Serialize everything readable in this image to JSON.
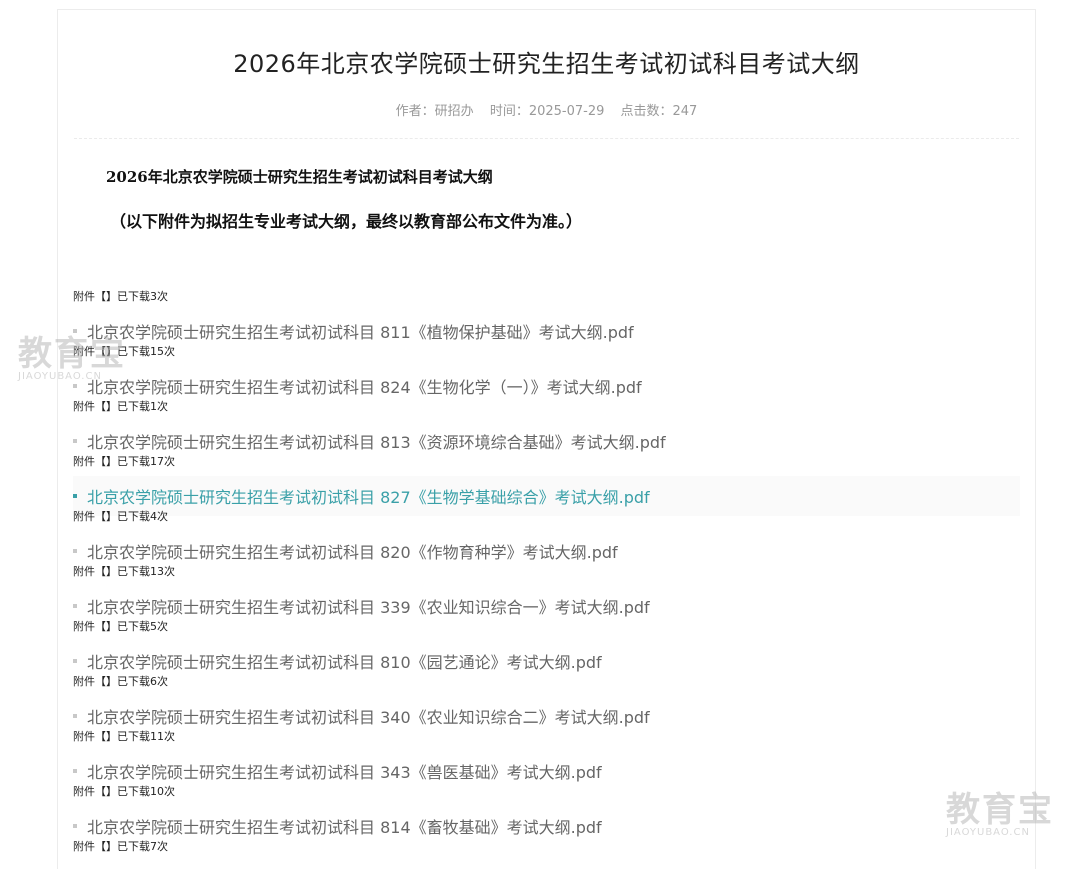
{
  "article": {
    "title": "2026年北京农学院硕士研究生招生考试初试科目考试大纲",
    "meta": {
      "author": "作者：研招办",
      "time": "时间：2025-07-29",
      "clicks": "点击数：247"
    },
    "body_heading": "2026年北京农学院硕士研究生招生考试初试科目考试大纲",
    "body_subheading": "（以下附件为拟招生专业考试大纲，最终以教育部公布文件为准。）"
  },
  "notes": [
    "附件【】已下载3次",
    "附件【】已下载15次",
    "附件【】已下载1次",
    "附件【】已下载17次",
    "附件【】已下载4次",
    "附件【】已下载13次",
    "附件【】已下载5次",
    "附件【】已下载6次",
    "附件【】已下载11次",
    "附件【】已下载10次",
    "附件【】已下载7次"
  ],
  "files": [
    "北京农学院硕士研究生招生考试初试科目 811《植物保护基础》考试大纲.pdf",
    "北京农学院硕士研究生招生考试初试科目 824《生物化学（一）》考试大纲.pdf",
    "北京农学院硕士研究生招生考试初试科目 813《资源环境综合基础》考试大纲.pdf",
    "北京农学院硕士研究生招生考试初试科目 827《生物学基础综合》考试大纲.pdf",
    "北京农学院硕士研究生招生考试初试科目 820《作物育种学》考试大纲.pdf",
    "北京农学院硕士研究生招生考试初试科目 339《农业知识综合一》考试大纲.pdf",
    "北京农学院硕士研究生招生考试初试科目 810《园艺通论》考试大纲.pdf",
    "北京农学院硕士研究生招生考试初试科目 340《农业知识综合二》考试大纲.pdf",
    "北京农学院硕士研究生招生考试初试科目 343《兽医基础》考试大纲.pdf",
    "北京农学院硕士研究生招生考试初试科目 814《畜牧基础》考试大纲.pdf"
  ],
  "watermark": {
    "brand": "教育宝",
    "domain": "JIAOYUBAO.CN"
  },
  "colors": {
    "link_active": "#3aa0a8",
    "link": "#666666"
  }
}
